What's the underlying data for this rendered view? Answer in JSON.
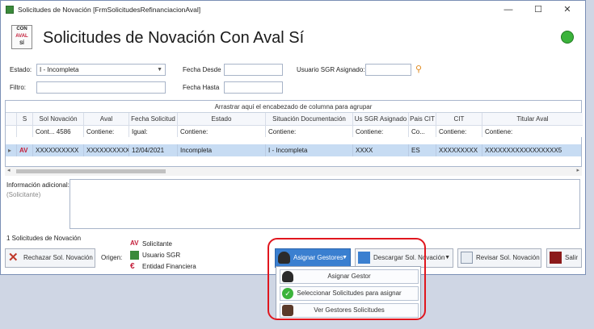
{
  "window": {
    "title": "Solicitudes de Novación [FrmSolicitudesRefinanciacionAval]",
    "minimize": "—",
    "maximize": "☐",
    "close": "✕"
  },
  "header": {
    "title": "Solicitudes de Novación Con Aval Sí",
    "logo_lines": [
      "CON",
      "AVAL",
      "SÍ"
    ]
  },
  "filters": {
    "estado_label": "Estado:",
    "estado_value": "I - Incompleta",
    "fecha_desde_label": "Fecha Desde",
    "fecha_desde_value": "",
    "usuario_label": "Usuario SGR Asignado:",
    "usuario_value": "",
    "filtro_label": "Filtro:",
    "filtro_value": "",
    "fecha_hasta_label": "Fecha Hasta",
    "fecha_hasta_value": ""
  },
  "grid": {
    "group_hint": "Arrastrar aquí el encabezado de columna para agrupar",
    "columns": [
      "S",
      "Sol Novación",
      "Aval",
      "Fecha Solicitud",
      "Estado",
      "Situación Documentación",
      "Us SGR Asignado",
      "Pais CIT",
      "CIT",
      "Titular Aval"
    ],
    "filters": [
      "",
      "Cont... 4586",
      "Contiene:",
      "Igual:",
      "Contiene:",
      "Contiene:",
      "Contiene:",
      "Co...",
      "Contiene:",
      "Contiene:"
    ],
    "rows": [
      {
        "sol": "XXXXXXXXXX",
        "aval": "XXXXXXXXXX",
        "fecha": "12/04/2021",
        "estado": "Incompleta",
        "situacion": "I - Incompleta",
        "usuario": "XXXX",
        "pais": "ES",
        "cit": "XXXXXXXXX",
        "titular": "XXXXXXXXXXXXXXXXX5"
      }
    ]
  },
  "info": {
    "label": "Información adicional:",
    "sublabel": "(Solicitante)",
    "value": ""
  },
  "footer": {
    "count": "1 Solicitudes de Novación",
    "origen_label": "Origen:",
    "legend": [
      "Solicitante",
      "Usuario SGR",
      "Entidad Financiera"
    ]
  },
  "buttons": {
    "rechazar": "Rechazar Sol. Novación",
    "asignar": "Asignar Gestores",
    "descargar": "Descargar Sol. Novación",
    "revisar": "Revisar Sol. Novación",
    "salir": "Salir"
  },
  "menu": {
    "items": [
      "Asignar Gestor",
      "Seleccionar Solicitudes para asignar",
      "Ver Gestores Solicitudes"
    ]
  },
  "colors": {
    "accent": "#3a7fd0",
    "highlight": "#e0161e",
    "row_selected": "#c7dcf3"
  }
}
